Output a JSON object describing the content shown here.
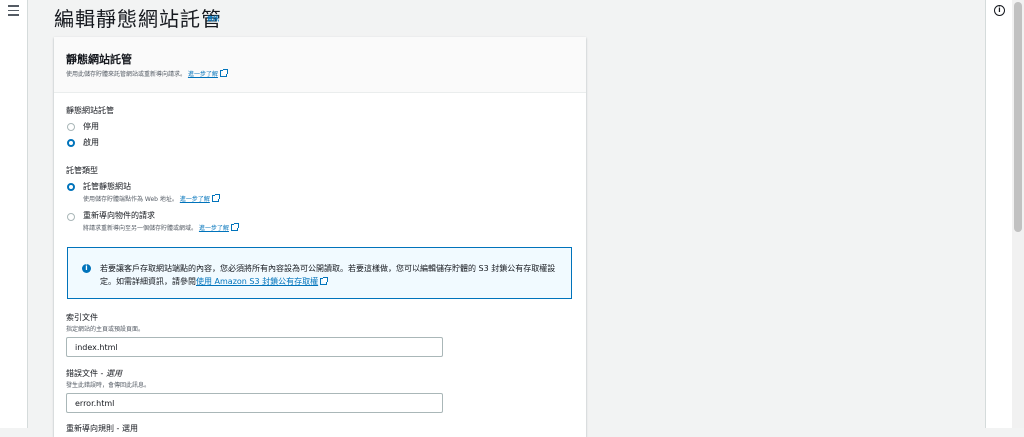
{
  "page": {
    "title": "編輯靜態網站託管",
    "info_link": "資訊"
  },
  "icons": {
    "menu": "hamburger-menu-icon",
    "help": "info-circle-icon",
    "external": "external-link-icon"
  },
  "colors": {
    "accent": "#0073bb",
    "alert_bg": "#f1faff",
    "page_bg": "#f2f3f3"
  },
  "panel": {
    "title": "靜態網站託管",
    "description": "使用此儲存貯體來託管網站或重新導向請求。",
    "learn_more": "進一步了解",
    "hosting": {
      "label": "靜態網站託管",
      "options": [
        {
          "label": "停用",
          "checked": false
        },
        {
          "label": "啟用",
          "checked": true
        }
      ]
    },
    "hosting_type": {
      "label": "託管類型",
      "options": [
        {
          "label": "託管靜態網站",
          "description": "使用儲存貯體端點作為 Web 地址。",
          "learn_more": "進一步了解",
          "checked": true
        },
        {
          "label": "重新導向物件的請求",
          "description": "將請求重新導向至另一個儲存貯體或網域。",
          "learn_more": "進一步了解",
          "checked": false
        }
      ]
    },
    "alert": {
      "text": "若要讓客戶存取網站端點的內容，您必須將所有內容設為可公開讀取。若要這樣做，您可以編輯儲存貯體的 S3 封鎖公有存取權設定。如需詳細資訊，請參閱",
      "link": "使用 Amazon S3 封鎖公有存取權"
    },
    "index_document": {
      "label": "索引文件",
      "description": "指定網站的主頁或預設頁面。",
      "value": "index.html"
    },
    "error_document": {
      "label": "錯誤文件 - ",
      "optional": "選用",
      "description": "發生此錯誤時，會傳回此訊息。",
      "value": "error.html"
    },
    "redirect_rules": {
      "label": "重新導向規則 - 選用"
    }
  }
}
